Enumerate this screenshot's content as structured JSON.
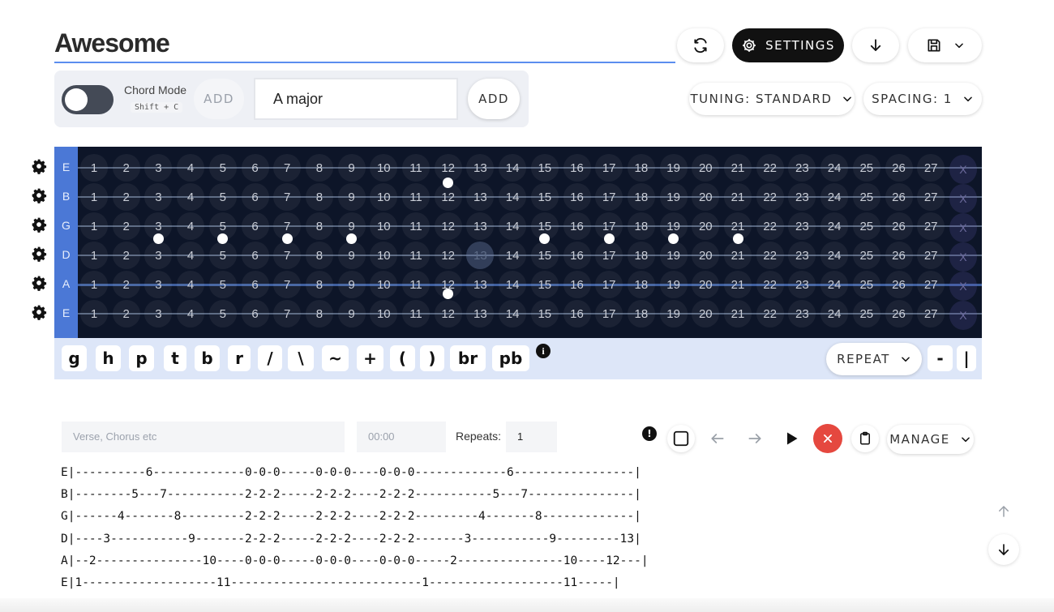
{
  "song": {
    "title": "Awesome"
  },
  "toolbar": {
    "refresh_icon": "refresh-icon",
    "settings_label": "SETTINGS",
    "download_icon": "arrow-down-icon",
    "save_icon": "floppy-disk-icon"
  },
  "chord": {
    "mode_label": "Chord Mode",
    "shortcut": "Shift + C",
    "add_left_label": "ADD",
    "input_value": "A major",
    "add_label": "ADD"
  },
  "options": {
    "tuning_label": "TUNING: STANDARD",
    "spacing_label": "SPACING: 1"
  },
  "fretboard": {
    "strings": [
      "E",
      "B",
      "G",
      "D",
      "A",
      "E"
    ],
    "frets": [
      "1",
      "2",
      "3",
      "4",
      "5",
      "6",
      "7",
      "8",
      "9",
      "10",
      "11",
      "12",
      "13",
      "14",
      "15",
      "16",
      "17",
      "18",
      "19",
      "20",
      "21",
      "22",
      "23",
      "24",
      "25",
      "26",
      "27"
    ],
    "clear_label": "X",
    "highlighted": {
      "string": 3,
      "fret": 13
    },
    "inlay_single_frets": [
      3,
      5,
      7,
      9,
      15,
      17,
      19,
      21
    ],
    "inlay_double_frets": [
      12
    ]
  },
  "techniques": {
    "items": [
      "g",
      "h",
      "p",
      "t",
      "b",
      "r",
      "/",
      "\\",
      "~",
      "+",
      "(",
      ")",
      "br",
      "pb"
    ],
    "info_label": "i",
    "repeat_label": "REPEAT",
    "dash_label": "-",
    "bar_label": "|"
  },
  "section": {
    "name_placeholder": "Verse, Chorus etc",
    "time_placeholder": "00:00",
    "repeats_label": "Repeats:",
    "repeats_value": "1",
    "alert_label": "!",
    "manage_label": "MANAGE",
    "delete_color": "#e5483f"
  },
  "tab": {
    "lines": [
      "E|----------6-------------0-0-0-----0-0-0----0-0-0-------------6-----------------|",
      "B|--------5---7-----------2-2-2-----2-2-2----2-2-2-----------5---7---------------|",
      "G|------4-------8---------2-2-2-----2-2-2----2-2-2---------4-------8-------------|",
      "D|----3-----------9-------2-2-2-----2-2-2----2-2-2-------3-----------9---------13|",
      "A|--2---------------10----0-0-0-----0-0-0----0-0-0-----2---------------10----12---|",
      "E|1-------------------11---------------------------1-------------------11-----|"
    ]
  }
}
